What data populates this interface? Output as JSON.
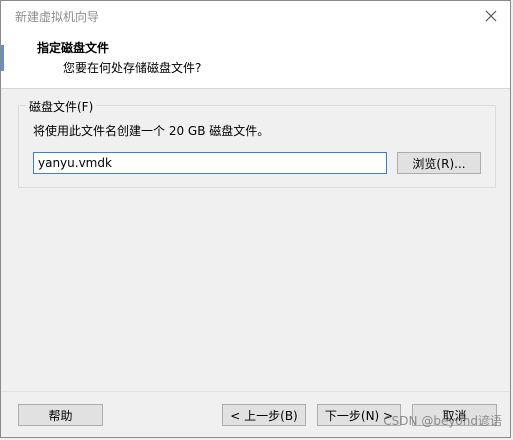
{
  "window": {
    "title": "新建虚拟机向导"
  },
  "header": {
    "title": "指定磁盘文件",
    "subtitle": "您要在何处存储磁盘文件?"
  },
  "disk_file_group": {
    "legend": "磁盘文件(F)",
    "description": "将使用此文件名创建一个 20 GB 磁盘文件。",
    "file_name_value": "yanyu.vmdk",
    "browse_label": "浏览(R)..."
  },
  "footer": {
    "help_label": "帮助",
    "back_label": "< 上一步(B)",
    "next_label": "下一步(N) >",
    "cancel_label": "取消"
  },
  "watermark": {
    "text": "CSDN @beyond谚语"
  },
  "colors": {
    "input_border": "#3b7fd0",
    "button_bg": "#e1e1e1",
    "window_bg": "#f0f0f0"
  }
}
